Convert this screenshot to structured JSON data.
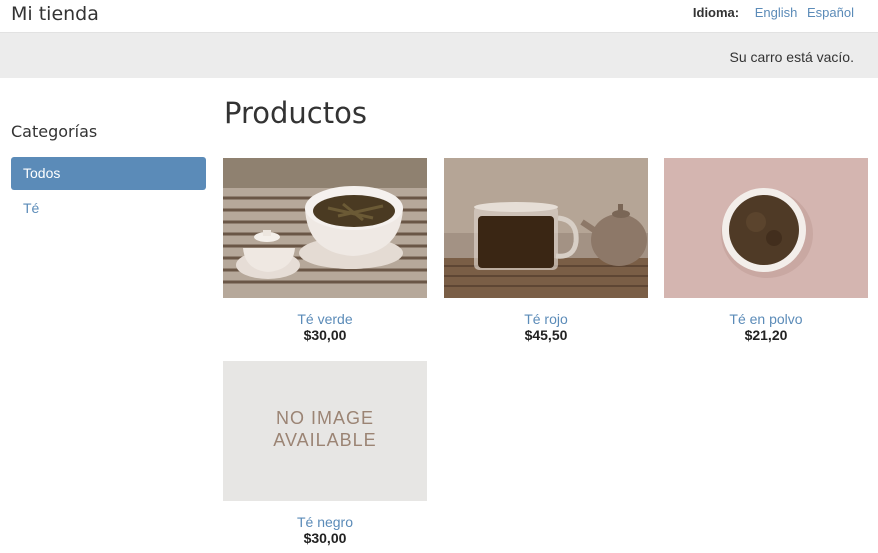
{
  "header": {
    "logo": "Mi tienda",
    "language_label": "Idioma:",
    "languages": [
      "English",
      "Español"
    ]
  },
  "cart": {
    "status": "Su carro está vacío."
  },
  "sidebar": {
    "title": "Categorías",
    "items": [
      {
        "label": "Todos",
        "active": true
      },
      {
        "label": "Té",
        "active": false
      }
    ]
  },
  "main": {
    "title": "Productos",
    "products": [
      {
        "name": "Té verde",
        "price": "$30,00",
        "image": "green-tea-photo"
      },
      {
        "name": "Té rojo",
        "price": "$45,50",
        "image": "red-tea-photo"
      },
      {
        "name": "Té en polvo",
        "price": "$21,20",
        "image": "tea-powder-photo"
      },
      {
        "name": "Té negro",
        "price": "$30,00",
        "image": "no-image-placeholder",
        "placeholder_text": [
          "NO IMAGE",
          "AVAILABLE"
        ]
      }
    ]
  },
  "colors": {
    "link": "#5b8bb8",
    "active_bg": "#5b8bb8",
    "cart_bar": "#ececec"
  }
}
